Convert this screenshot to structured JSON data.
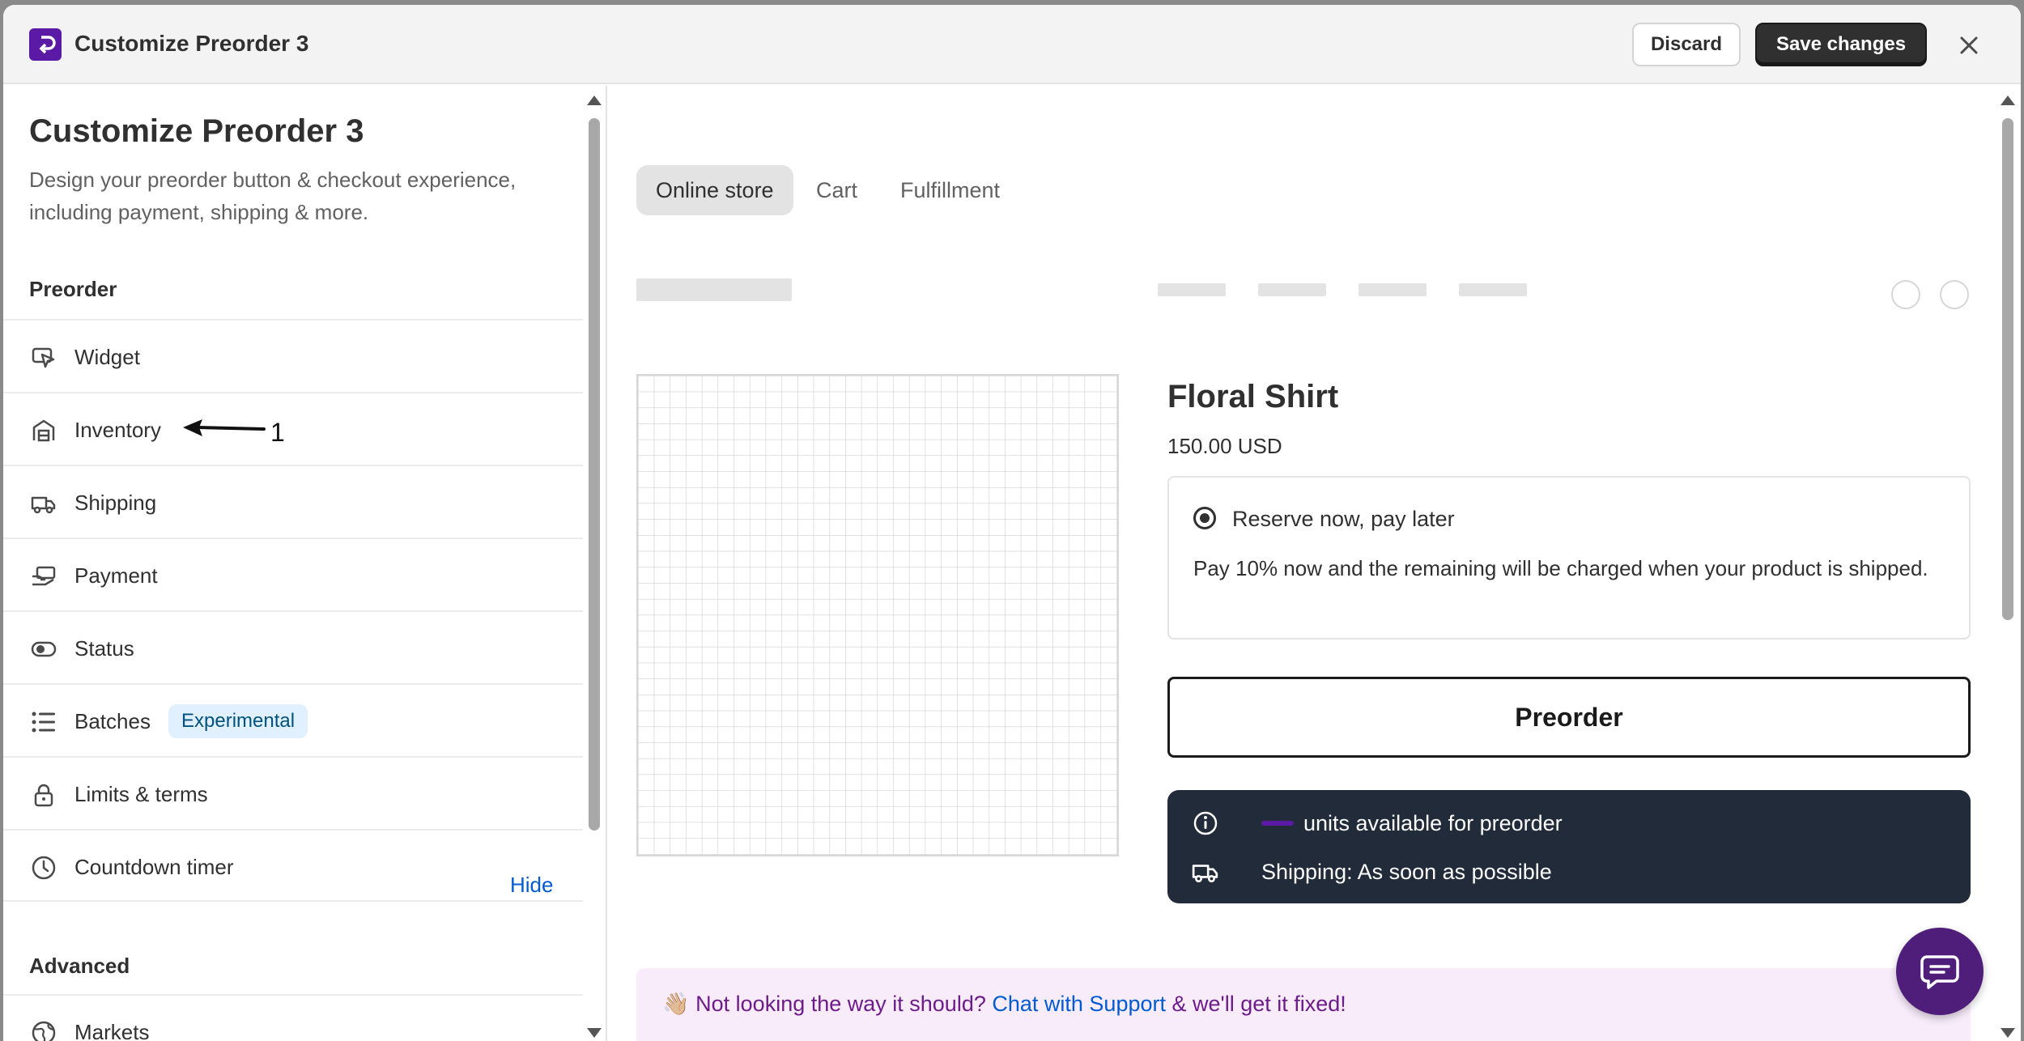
{
  "header": {
    "title": "Customize Preorder 3",
    "discard_label": "Discard",
    "save_label": "Save changes"
  },
  "sidebar": {
    "title": "Customize Preorder 3",
    "description": "Design your preorder button & checkout experience, including payment, shipping & more.",
    "section_preorder": "Preorder",
    "items": [
      {
        "label": "Widget",
        "icon": "cursor-pointer-icon"
      },
      {
        "label": "Inventory",
        "icon": "warehouse-icon"
      },
      {
        "label": "Shipping",
        "icon": "delivery-truck-icon"
      },
      {
        "label": "Payment",
        "icon": "hand-money-icon"
      },
      {
        "label": "Status",
        "icon": "toggle-icon"
      },
      {
        "label": "Batches",
        "icon": "list-icon",
        "badge": "Experimental"
      },
      {
        "label": "Limits & terms",
        "icon": "lock-icon"
      },
      {
        "label": "Countdown timer",
        "icon": "clock-icon"
      }
    ],
    "section_advanced": "Advanced",
    "hide_label": "Hide",
    "advanced_items": [
      {
        "label": "Markets",
        "icon": "globe-icon"
      }
    ],
    "annotation_number": "1"
  },
  "main": {
    "tabs": [
      {
        "label": "Online store",
        "active": true
      },
      {
        "label": "Cart",
        "active": false
      },
      {
        "label": "Fulfillment",
        "active": false
      }
    ],
    "product": {
      "title": "Floral Shirt",
      "price": "150.00 USD",
      "option_title": "Reserve now, pay later",
      "option_description": "Pay 10% now and the remaining will be charged when your product is shipped.",
      "button_label": "Preorder",
      "units_text": "units available for preorder",
      "shipping_text": "Shipping: As soon as possible"
    },
    "help_banner": {
      "emoji": "👋🏼",
      "prefix": "Not looking the way it should?",
      "link": "Chat with Support",
      "suffix": "& we'll get it fixed!"
    }
  },
  "colors": {
    "brand": "#5b1aa5",
    "primary_button": "#303030",
    "info_box": "#212b3a",
    "banner_bg": "#f8ecfb",
    "banner_text": "#6e1b8a",
    "link": "#005bd3",
    "badge_bg": "#e0f0ff"
  }
}
